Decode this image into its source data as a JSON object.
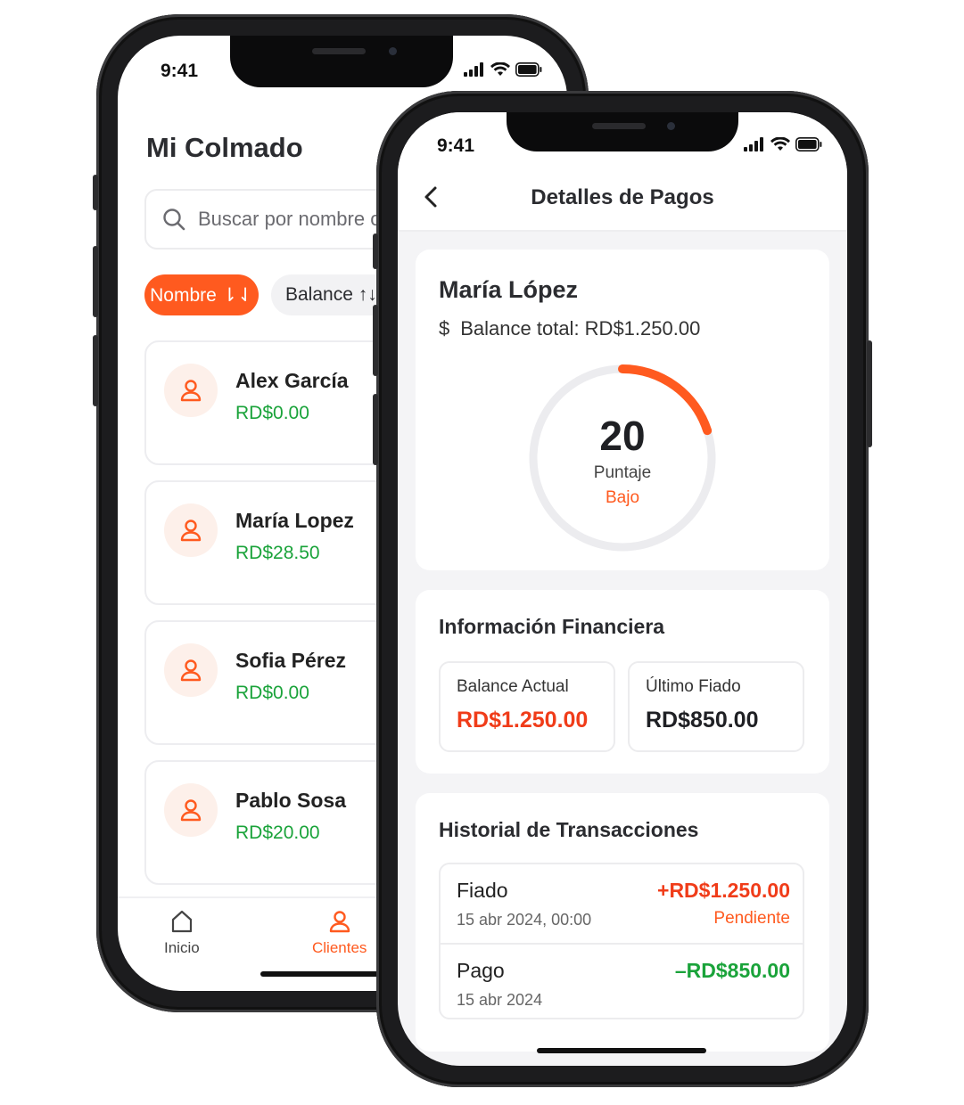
{
  "colors": {
    "accent": "#ff5a1f",
    "positive": "#1aa33a",
    "negative": "#f03c19"
  },
  "back_phone": {
    "status_time": "9:41",
    "app_title": "Mi Colmado",
    "search_placeholder": "Buscar por nombre o teléfono",
    "sort_chips": [
      {
        "label": "Nombre ⇂⇃",
        "active": true
      },
      {
        "label": "Balance ↑↓",
        "active": false
      }
    ],
    "clients": [
      {
        "name": "Alex García",
        "balance": "RD$0.00"
      },
      {
        "name": "María Lopez",
        "balance": "RD$28.50"
      },
      {
        "name": "Sofia Pérez",
        "balance": "RD$0.00"
      },
      {
        "name": "Pablo Sosa",
        "balance": "RD$20.00"
      }
    ],
    "tabs": [
      {
        "label": "Inicio",
        "icon": "home-icon"
      },
      {
        "label": "Clientes",
        "icon": "user-icon"
      }
    ]
  },
  "front_phone": {
    "status_time": "9:41",
    "nav_title": "Detalles de Pagos",
    "customer": {
      "name": "María López",
      "currency_symbol": "$",
      "balance_total": "Balance total: RD$1.250.00"
    },
    "score": {
      "value": "20",
      "label": "Puntaje",
      "level": "Bajo",
      "fraction": 0.2
    },
    "financial": {
      "title": "Información Financiera",
      "current_label": "Balance Actual",
      "current_value": "RD$1.250.00",
      "last_label": "Último Fiado",
      "last_value": "RD$850.00"
    },
    "history": {
      "title": "Historial de Transacciones",
      "items": [
        {
          "type": "Fiado",
          "date": "15 abr 2024, 00:00",
          "amount": "+RD$1.250.00",
          "status": "Pendiente"
        },
        {
          "type": "Pago",
          "date": "15 abr 2024",
          "amount": "–RD$850.00",
          "status": ""
        }
      ]
    }
  }
}
